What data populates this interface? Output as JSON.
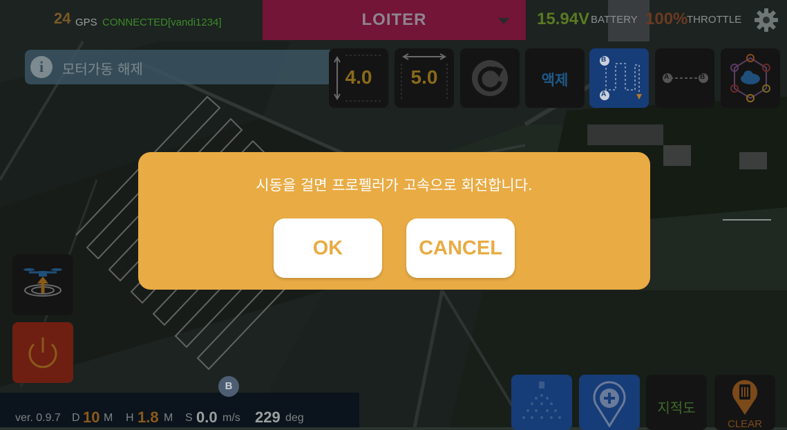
{
  "header": {
    "gps_count": "24",
    "gps_label": "GPS",
    "connection": "CONNECTED[vandi1234]",
    "flight_mode": "LOITER",
    "battery_voltage": "15.94V",
    "battery_label": "BATTERY",
    "throttle_value": "100%",
    "throttle_label": "THROTTLE",
    "settings_icon": "gear-icon"
  },
  "info_bar": {
    "icon": "info-icon",
    "icon_glyph": "i",
    "text": "모터가동 해제"
  },
  "toolbar": {
    "height_value": "4.0",
    "width_value": "5.0",
    "rotate_icon": "rotate-icon",
    "liquid_label": "액제",
    "route_ab_icon": "ab-route-icon",
    "route_line_icon": "a-to-b-line-icon",
    "network_icon": "network-icon",
    "point_a": "A",
    "point_b": "B"
  },
  "side_buttons": {
    "takeoff_icon": "drone-takeoff-icon",
    "power_icon": "power-icon"
  },
  "bottom_buttons": {
    "spray_icon": "spray-icon",
    "add_point_icon": "add-waypoint-icon",
    "field_label": "지적도",
    "clear_label": "CLEAR",
    "clear_icon": "trash-icon"
  },
  "status_bar": {
    "version": "ver. 0.9.7",
    "distance_label": "D",
    "distance_value": "10",
    "distance_unit": "M",
    "height_label": "H",
    "height_value": "1.8",
    "height_unit": "M",
    "speed_label": "S",
    "speed_value": "0.0",
    "speed_unit": "m/s",
    "heading_value": "229",
    "heading_unit": "deg"
  },
  "map": {
    "marker_b": "B"
  },
  "dialog": {
    "message": "시동을 걸면 프로펠러가 고속으로 회전합니다.",
    "ok_label": "OK",
    "cancel_label": "CANCEL",
    "background_color": "#e9ab44"
  }
}
